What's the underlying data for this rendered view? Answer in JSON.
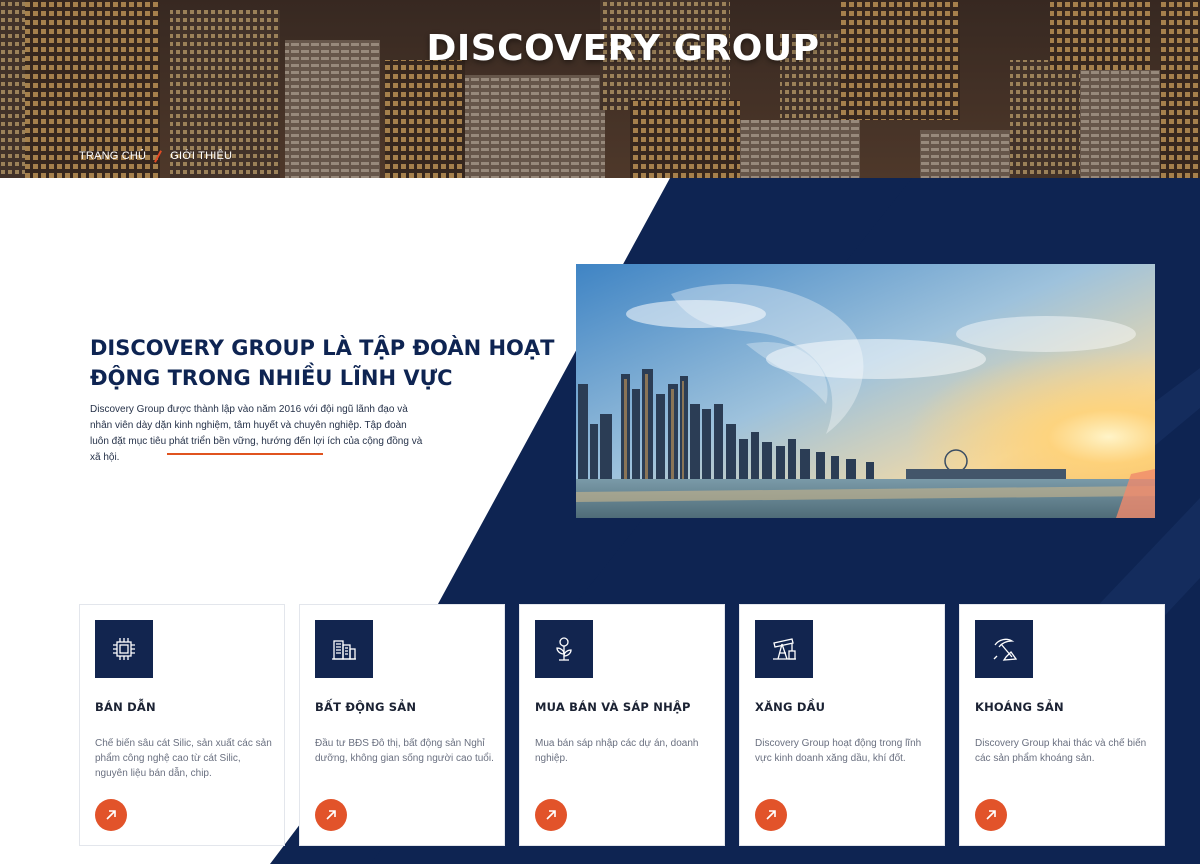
{
  "hero": {
    "title": "DISCOVERY GROUP",
    "breadcrumb": {
      "home": "TRANG CHỦ",
      "current": "GIỚI THIỆU"
    }
  },
  "intro": {
    "heading": "DISCOVERY GROUP LÀ TẬP ĐOÀN HOẠT ĐỘNG TRONG NHIỀU LĨNH VỰC",
    "description": "Discovery Group được thành lập vào năm 2016 với đội ngũ lãnh đạo và nhân viên dày dặn kinh nghiệm, tâm huyết và chuyên nghiệp. Tập đoàn luôn đặt mục tiêu phát triển bền vững, hướng đến lợi ích của cộng đồng và xã hội."
  },
  "cards": [
    {
      "icon": "chip-icon",
      "title": "BÁN DẪN",
      "description": "Chế biến sâu cát Silic, sản xuất các sản phẩm công nghệ cao từ cát Silic, nguyên liệu bán dẫn, chip."
    },
    {
      "icon": "buildings-icon",
      "title": "BẤT ĐỘNG SẢN",
      "description": "Đầu tư BĐS Đô thị, bất động sản Nghỉ dưỡng, không gian sống người cao tuổi."
    },
    {
      "icon": "plant-money-icon",
      "title": "MUA BÁN VÀ SÁP NHẬP",
      "description": "Mua bán sáp nhập các dự án, doanh nghiệp."
    },
    {
      "icon": "oil-pump-icon",
      "title": "XĂNG DẦU",
      "description": "Discovery Group hoạt động trong lĩnh vực kinh doanh xăng dầu, khí đốt."
    },
    {
      "icon": "pickaxe-icon",
      "title": "KHOÁNG SẢN",
      "description": "Discovery Group khai thác và chế biến các sản phẩm khoáng sản."
    }
  ],
  "colors": {
    "navy": "#0e2452",
    "accent": "#e2532a",
    "card_icon_bg": "#12254f"
  }
}
